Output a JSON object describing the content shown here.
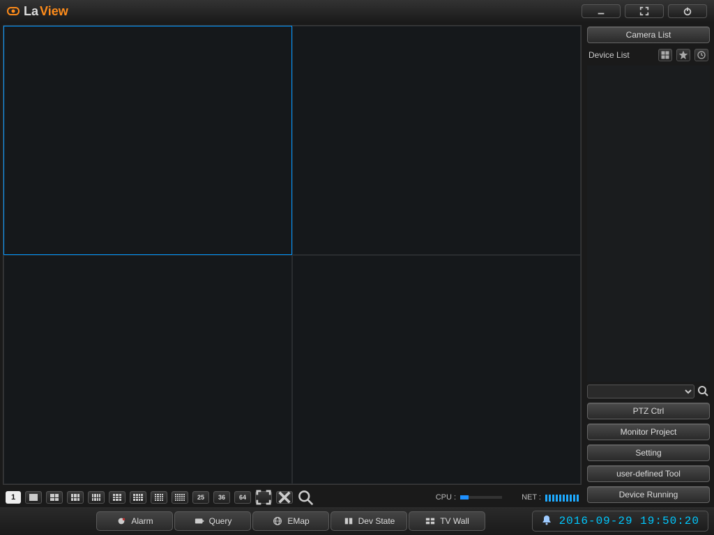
{
  "brand": {
    "la": "La",
    "view": "View"
  },
  "titlebar": {
    "minimize_title": "Minimize",
    "fullscreen_title": "Fullscreen",
    "power_title": "Power"
  },
  "viewer": {
    "page_number": "1",
    "layout_25": "25",
    "layout_36": "36",
    "layout_64": "64",
    "cpu_label": "CPU :",
    "net_label": "NET :"
  },
  "sidebar": {
    "camera_list": "Camera List",
    "device_list": "Device List",
    "ptz_ctrl": "PTZ Ctrl",
    "monitor_project": "Monitor Project",
    "setting": "Setting",
    "user_tool": "user-defined Tool",
    "device_running": "Device Running"
  },
  "tabs": {
    "alarm": "Alarm",
    "query": "Query",
    "emap": "EMap",
    "dev_state": "Dev State",
    "tv_wall": "TV Wall"
  },
  "clock": "2016-09-29 19:50:20"
}
